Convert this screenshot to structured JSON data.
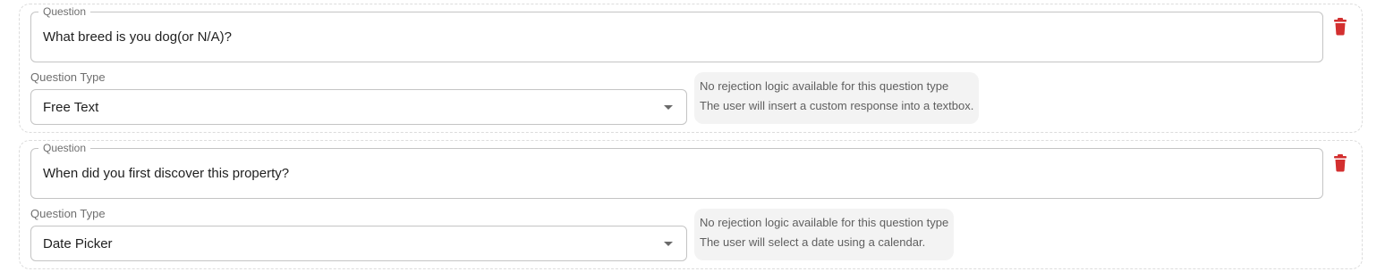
{
  "questions": [
    {
      "legend": "Question",
      "text": "What breed is you dog(or N/A)?",
      "type_label": "Question Type",
      "type_value": "Free Text",
      "info_line_1": "No rejection logic available for this question type",
      "info_line_2": "The user will insert a custom response into a textbox."
    },
    {
      "legend": "Question",
      "text": "When did you first discover this property?",
      "type_label": "Question Type",
      "type_value": "Date Picker",
      "info_line_1": "No rejection logic available for this question type",
      "info_line_2": "The user will select a date using a calendar."
    }
  ],
  "icons": {
    "delete": "trash-icon",
    "dropdown": "chevron-down-icon"
  },
  "colors": {
    "delete": "#d32f2f",
    "border": "#c4c4c4",
    "info_background": "#f3f3f3"
  }
}
